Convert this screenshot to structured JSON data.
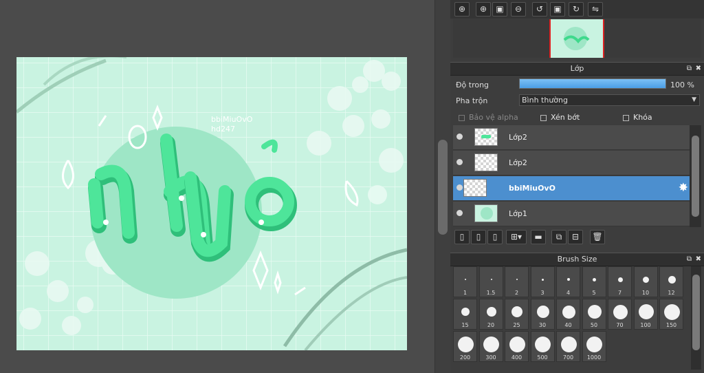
{
  "navigator": {
    "toolbar": [
      {
        "name": "zoom-fit-icon",
        "glyph": "⊕"
      },
      {
        "name": "zoom-in-icon",
        "glyph": "⊕"
      },
      {
        "name": "fit-window-icon",
        "glyph": "▣"
      },
      {
        "name": "zoom-out-icon",
        "glyph": "⊖"
      },
      {
        "name": "rotate-left-icon",
        "glyph": "↺"
      },
      {
        "name": "reset-view-icon",
        "glyph": "▣"
      },
      {
        "name": "rotate-right-icon",
        "glyph": "↻"
      },
      {
        "name": "flip-horizontal-icon",
        "glyph": "⇋"
      }
    ]
  },
  "layer_panel": {
    "title": "Lớp",
    "opacity_label": "Độ trong",
    "opacity_value": "100 %",
    "opacity_percent": 100,
    "blend_label": "Pha trộn",
    "blend_value": "Bình thường",
    "protect_alpha": "Bảo vệ alpha",
    "clipping": "Xén bớt",
    "lock": "Khóa",
    "layers": [
      {
        "name": "Lớp2",
        "selected": false,
        "thumb": "text"
      },
      {
        "name": "Lớp2",
        "selected": false,
        "thumb": "empty"
      },
      {
        "name": "bbiMiuOvO",
        "selected": true,
        "thumb": "empty"
      },
      {
        "name": "Lớp1",
        "selected": false,
        "thumb": "circle"
      }
    ],
    "tools": [
      {
        "name": "new-layer-icon",
        "glyph": "▯"
      },
      {
        "name": "new-8bit-layer-icon",
        "glyph": "▯"
      },
      {
        "name": "new-1bit-layer-icon",
        "glyph": "▯"
      },
      {
        "name": "add-layer-menu-icon",
        "glyph": "⊞▾"
      },
      {
        "name": "new-folder-icon",
        "glyph": "▬"
      },
      {
        "name": "duplicate-layer-icon",
        "glyph": "⧉"
      },
      {
        "name": "merge-down-icon",
        "glyph": "⊟"
      },
      {
        "name": "delete-layer-icon",
        "glyph": "🗑"
      }
    ]
  },
  "brush_panel": {
    "title": "Brush Size",
    "sizes": [
      "1",
      "1.5",
      "2",
      "3",
      "4",
      "5",
      "7",
      "10",
      "12",
      "15",
      "20",
      "25",
      "30",
      "40",
      "50",
      "70",
      "100",
      "150",
      "200",
      "300",
      "400",
      "500",
      "700",
      "1000"
    ]
  },
  "artwork": {
    "signature_line1": "bbiMiuOvO",
    "signature_line2": "hd247",
    "lettering": "nhớ"
  }
}
